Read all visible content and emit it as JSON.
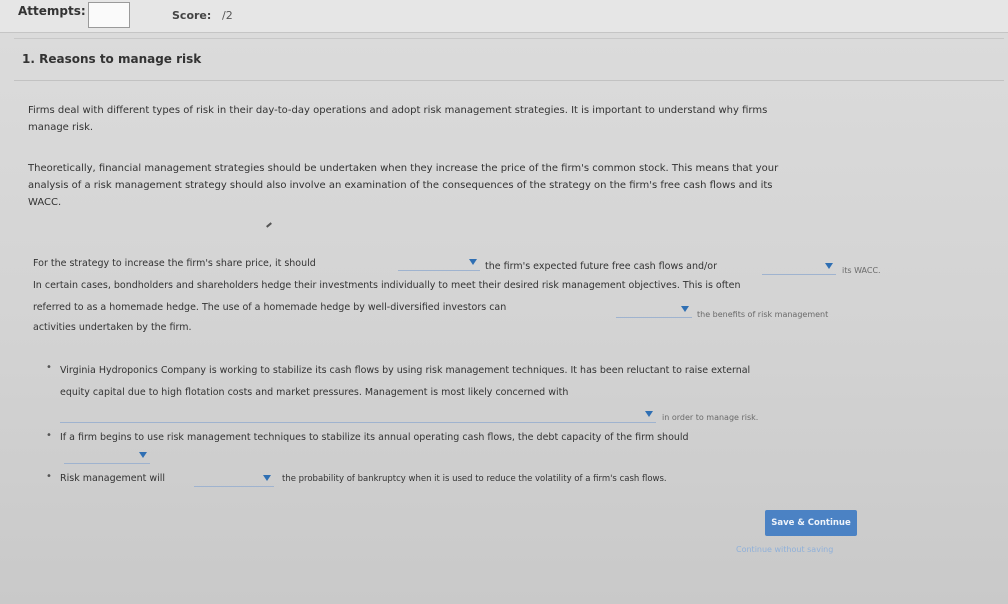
{
  "header": {
    "attempts_label": "Attempts:",
    "score_label": "Score:",
    "score_value": "/2"
  },
  "question": {
    "title": "1. Reasons to manage risk",
    "p1_a": "Firms deal with different types of risk in their day-to-day operations and adopt risk management strategies. It is important to understand why firms",
    "p1_b": "manage risk.",
    "p2_a": "Theoretically, financial management strategies should be undertaken when they increase the price of the firm's common stock. This means that your",
    "p2_b": "analysis of a risk management strategy should also involve an examination of the consequences of the strategy on the firm's free cash flows and its",
    "p2_c": "WACC.",
    "s1_a": "For the strategy to increase the firm's share price, it should",
    "s1_b": "the firm's expected future free cash flows and/or",
    "s1_c": "its WACC.",
    "s2": "In certain cases, bondholders and shareholders hedge their investments individually to meet their desired risk management objectives. This is often",
    "s3_a": "referred to as a homemade hedge. The use of a homemade hedge by well-diversified investors can",
    "s3_b": "the benefits of risk management",
    "s4": "activities undertaken by the firm."
  },
  "bullets": {
    "b1_a": "Virginia Hydroponics Company is working to stabilize its cash flows by using risk management techniques. It has been reluctant to raise external",
    "b1_b": "equity capital due to high flotation costs and market pressures. Management is most likely concerned with",
    "b1_c": "in order to manage risk.",
    "b2": "If a firm begins to use risk management techniques to stabilize its annual operating cash flows, the debt capacity of the firm should",
    "b3_a": "Risk management will",
    "b3_b": "the probability of bankruptcy when it is used to reduce the volatility of a firm's cash flows."
  },
  "actions": {
    "save": "Save & Continue",
    "continue": "Continue without saving"
  }
}
